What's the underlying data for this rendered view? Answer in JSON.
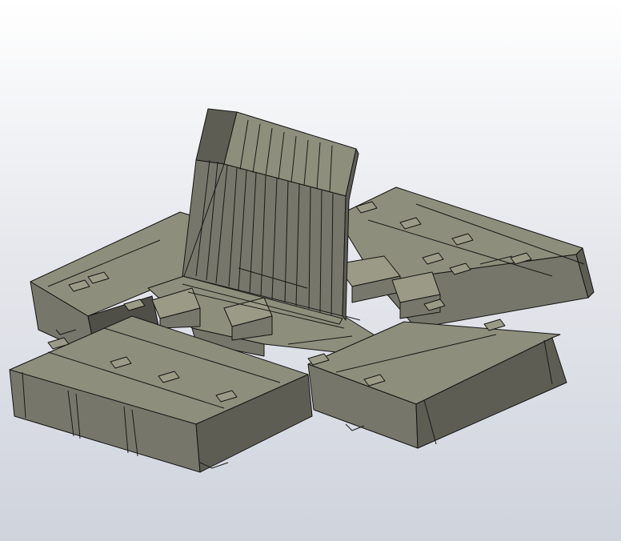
{
  "viewport": {
    "background_top": "#ffffff",
    "background_bottom": "#cfd3dc",
    "model_color": "#8e8e7c",
    "edge_color": "#141414"
  },
  "model": {
    "description_shown": ""
  }
}
